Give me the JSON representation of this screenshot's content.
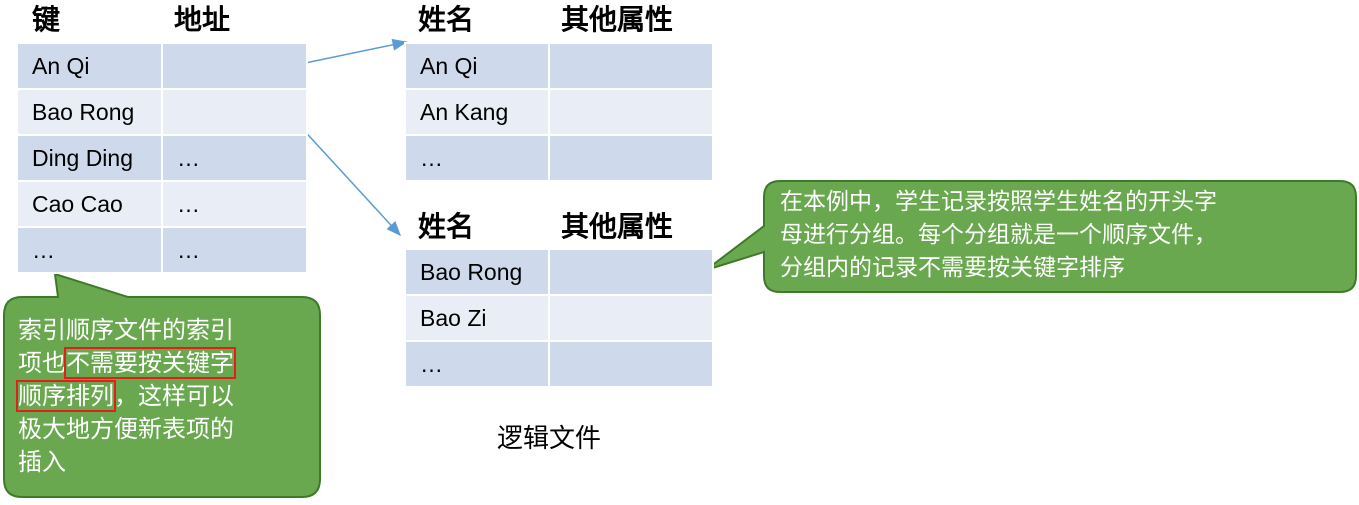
{
  "index_table": {
    "headers": [
      "键",
      "地址"
    ],
    "rows": [
      [
        "An Qi",
        ""
      ],
      [
        "Bao Rong",
        ""
      ],
      [
        "Ding Ding",
        "…"
      ],
      [
        "Cao Cao",
        "…"
      ],
      [
        "…",
        "…"
      ]
    ]
  },
  "group_a": {
    "headers": [
      "姓名",
      "其他属性"
    ],
    "rows": [
      [
        "An Qi",
        ""
      ],
      [
        "An Kang",
        ""
      ],
      [
        "…",
        ""
      ]
    ]
  },
  "group_b": {
    "headers": [
      "姓名",
      "其他属性"
    ],
    "rows": [
      [
        "Bao Rong",
        ""
      ],
      [
        "Bao Zi",
        ""
      ],
      [
        "…",
        ""
      ]
    ]
  },
  "caption": "逻辑文件",
  "callout_right": {
    "lines": [
      "在本例中，学生记录按照学生姓名的开头字",
      "母进行分组。每个分组就是一个顺序文件，",
      "分组内的记录不需要按关键字排序"
    ]
  },
  "callout_left": {
    "line1": "索引顺序文件的索引",
    "line2_plain": "项也",
    "line2_highlight": "不需要按关键字",
    "line3_highlight": "顺序排列",
    "line3_plain": "，这样可以",
    "line4": "极大地方便新表项的",
    "line5": "插入"
  },
  "colors": {
    "callout_fill": "#6aa84f",
    "callout_border": "#3d7a2a",
    "row_dark": "#cfd9ec",
    "row_light": "#e8edf6",
    "arrow": "#5b9bd5",
    "highlight_box": "#e0201b"
  }
}
